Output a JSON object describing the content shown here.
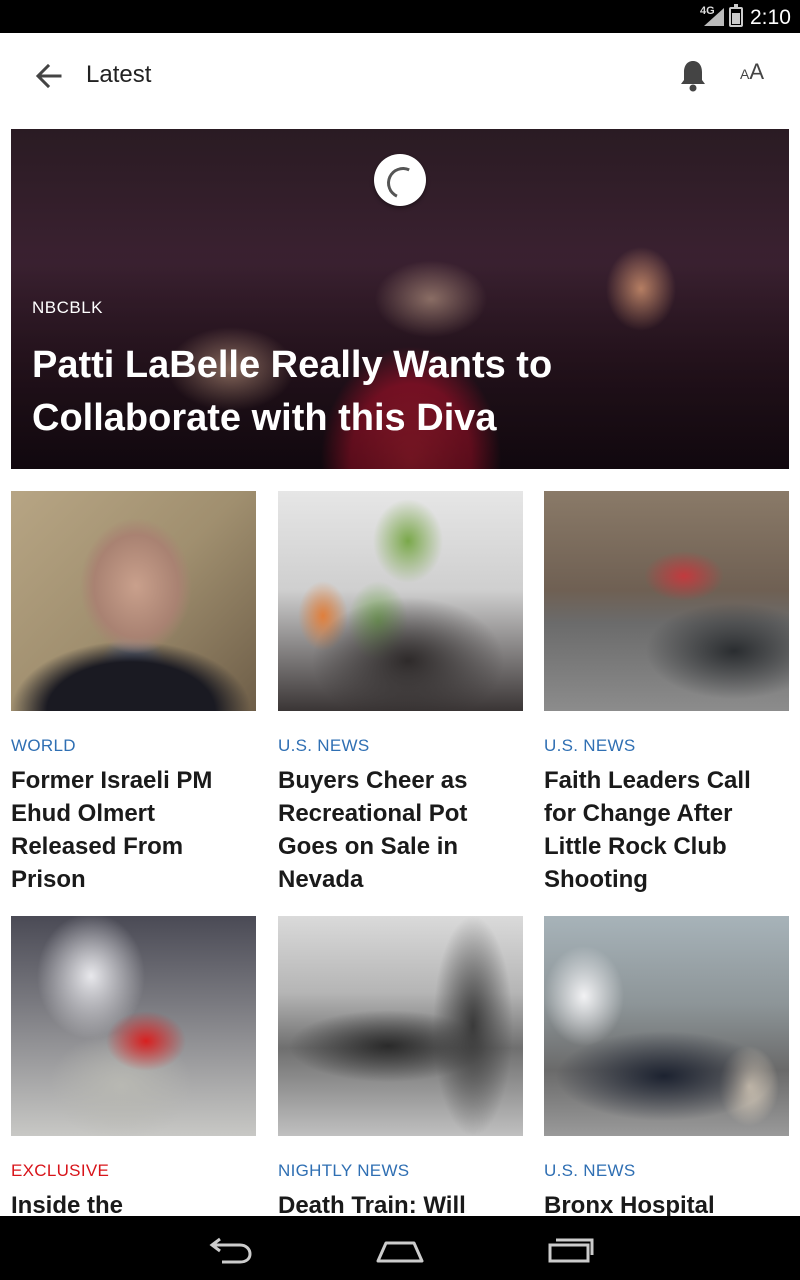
{
  "status_bar": {
    "network": "4G",
    "time": "2:10"
  },
  "app_bar": {
    "title": "Latest",
    "icons": [
      "back-arrow-icon",
      "bell-icon",
      "text-size-icon"
    ],
    "text_size_small": "A",
    "text_size_large": "A"
  },
  "hero": {
    "category": "NBCBLK",
    "headline": "Patti LaBelle Really Wants to Collaborate with this Diva"
  },
  "articles": [
    {
      "category": "WORLD",
      "headline": "Former Israeli PM Ehud Olmert Released From Prison"
    },
    {
      "category": "U.S. NEWS",
      "headline": "Buyers Cheer as Recreational Pot Goes on Sale in Nevada"
    },
    {
      "category": "U.S. NEWS",
      "headline": "Faith Leaders Call for Change After Little Rock Club Shooting"
    },
    {
      "category": "EXCLUSIVE",
      "headline": "Inside the"
    },
    {
      "category": "NIGHTLY NEWS",
      "headline": "Death Train: Will"
    },
    {
      "category": "U.S. NEWS",
      "headline": "Bronx Hospital"
    }
  ],
  "colors": {
    "category_blue": "#2f6fb3",
    "exclusive_red": "#d8141a"
  },
  "nav_bar": {
    "icons": [
      "back-icon",
      "home-icon",
      "recent-apps-icon"
    ]
  }
}
